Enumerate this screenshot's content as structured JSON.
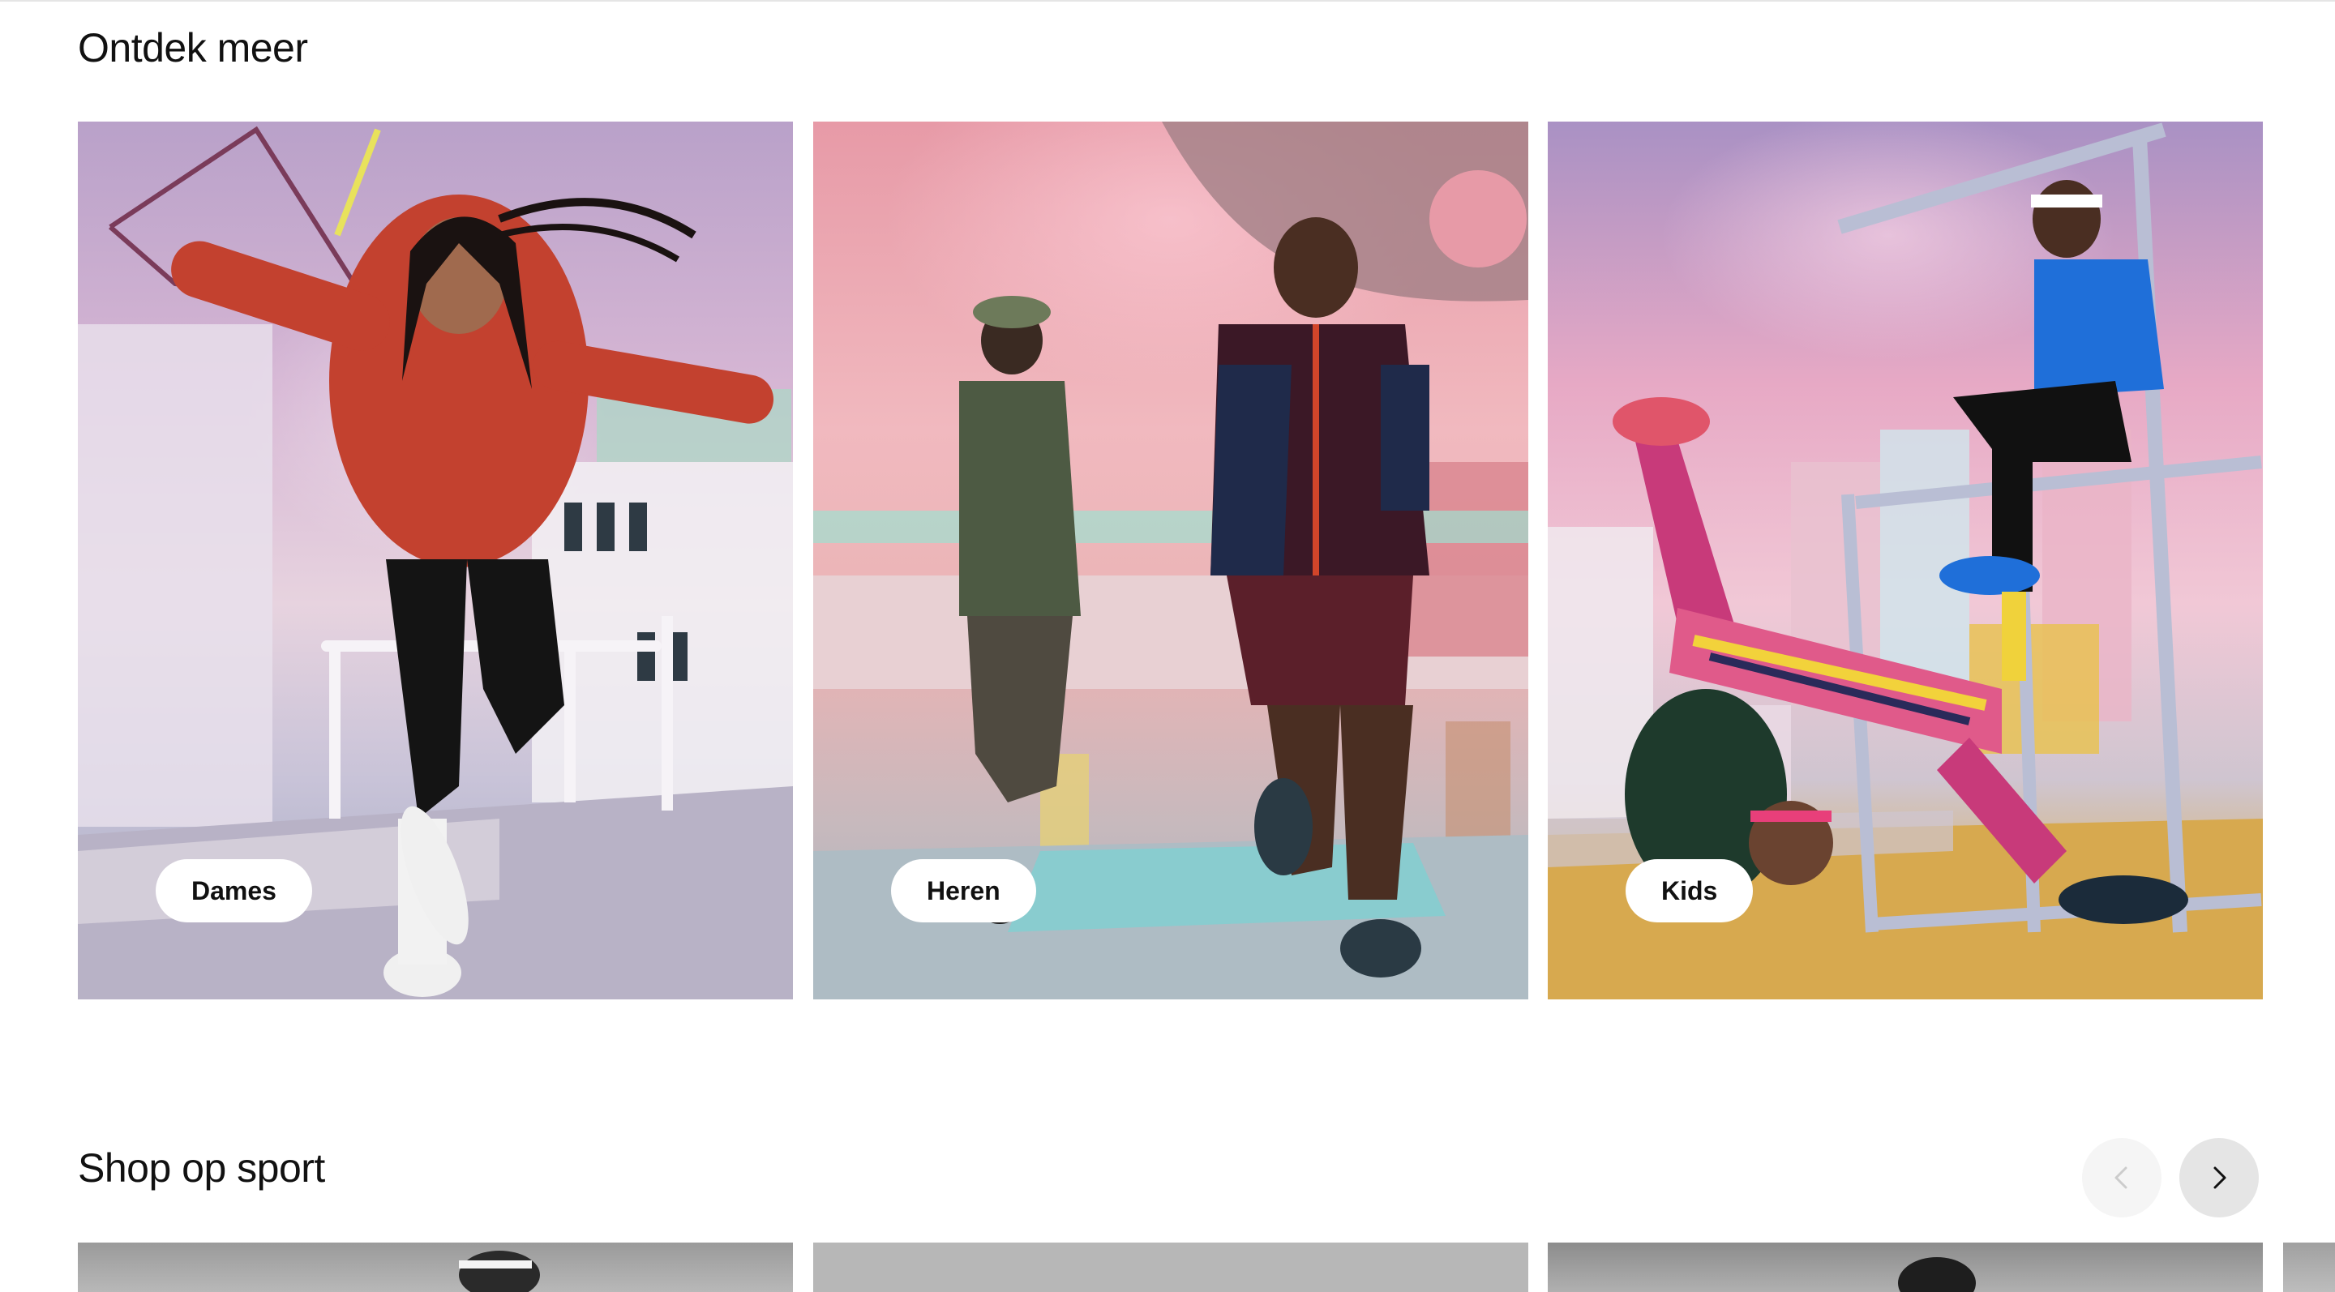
{
  "sections": {
    "discover": {
      "title": "Ontdek meer",
      "cards": [
        {
          "label": "Dames"
        },
        {
          "label": "Heren"
        },
        {
          "label": "Kids"
        }
      ]
    },
    "shop_by_sport": {
      "title": "Shop op sport"
    }
  },
  "carousel": {
    "prev_icon": "chevron-left-icon",
    "next_icon": "chevron-right-icon",
    "prev_enabled": false,
    "next_enabled": true
  },
  "colors": {
    "pill_bg": "#ffffff",
    "text": "#111111",
    "nav_prev_bg": "#f5f5f5",
    "nav_next_bg": "#e5e5e5"
  }
}
